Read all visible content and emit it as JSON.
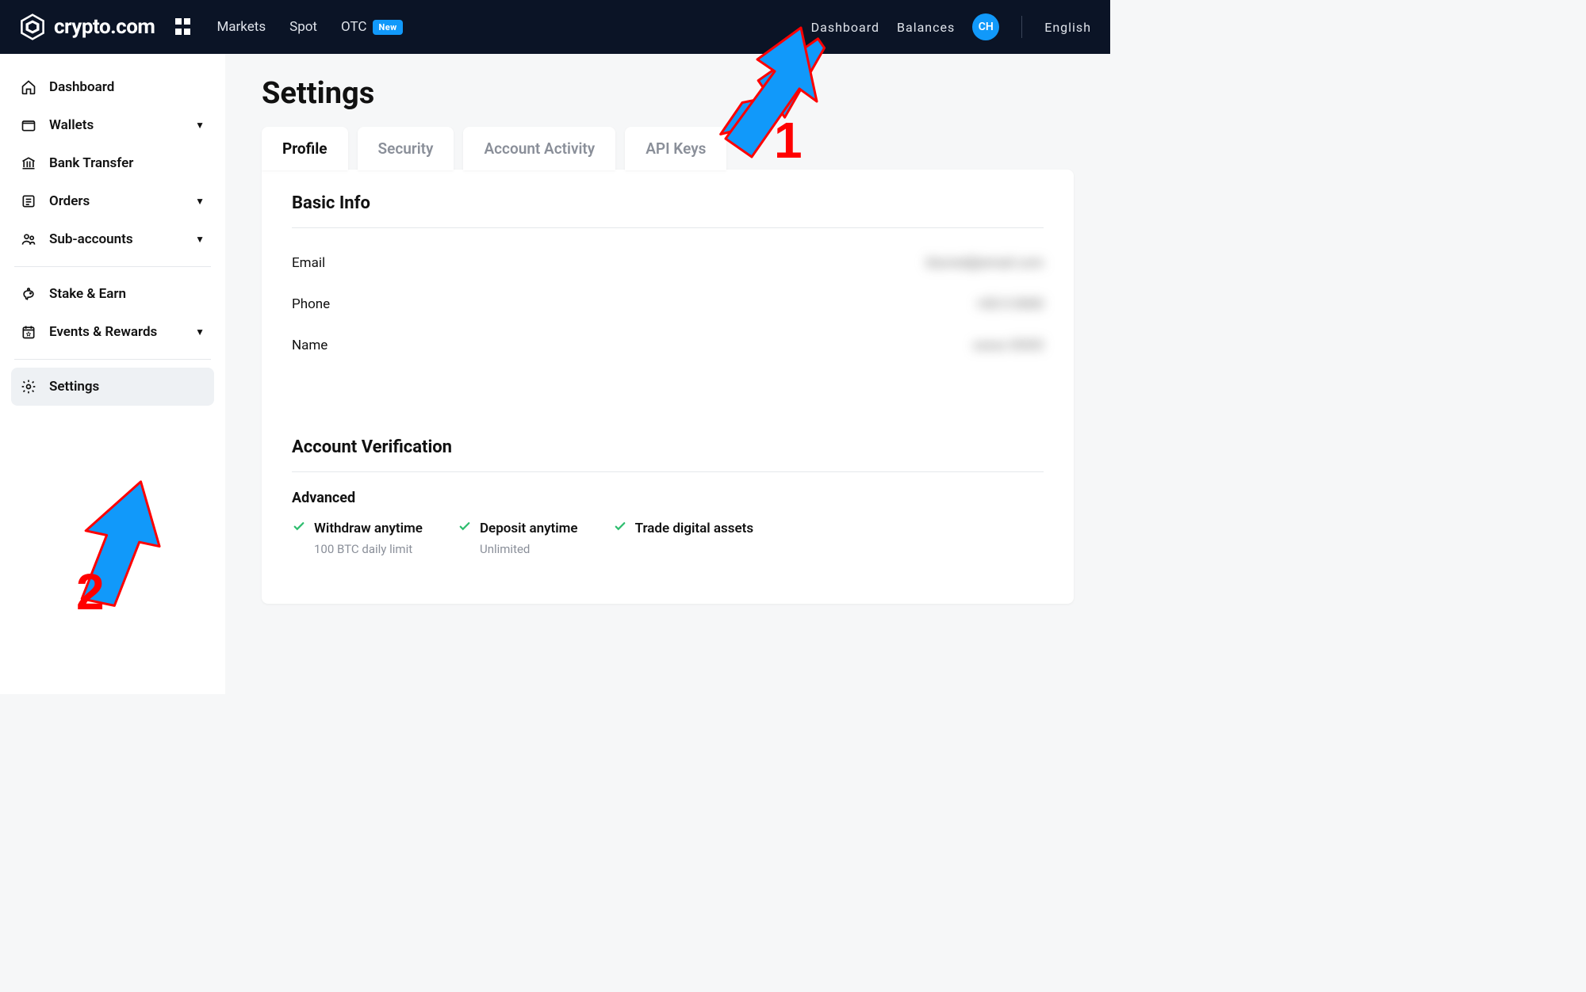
{
  "header": {
    "brand": "crypto.com",
    "nav_left": [
      "Markets",
      "Spot",
      "OTC"
    ],
    "otc_badge": "New",
    "nav_right": [
      "Dashboard",
      "Balances"
    ],
    "avatar_initials": "CH",
    "language": "English"
  },
  "sidebar": {
    "items": [
      {
        "label": "Dashboard",
        "icon": "home",
        "expandable": false
      },
      {
        "label": "Wallets",
        "icon": "wallet",
        "expandable": true
      },
      {
        "label": "Bank Transfer",
        "icon": "bank",
        "expandable": false
      },
      {
        "label": "Orders",
        "icon": "orders",
        "expandable": true
      },
      {
        "label": "Sub-accounts",
        "icon": "sub",
        "expandable": true
      },
      {
        "label": "Stake & Earn",
        "icon": "piggy",
        "expandable": false
      },
      {
        "label": "Events & Rewards",
        "icon": "calendar",
        "expandable": true
      },
      {
        "label": "Settings",
        "icon": "gear",
        "expandable": false,
        "active": true
      }
    ]
  },
  "page": {
    "title": "Settings",
    "tabs": [
      "Profile",
      "Security",
      "Account Activity",
      "API Keys"
    ],
    "active_tab": 0,
    "basic_info": {
      "heading": "Basic Info",
      "rows": [
        {
          "label": "Email",
          "value": "blurred@email.com"
        },
        {
          "label": "Phone",
          "value": "+00 0 0000"
        },
        {
          "label": "Name",
          "value": "xxxxx XXXX"
        }
      ]
    },
    "verification": {
      "heading": "Account Verification",
      "sub_heading": "Advanced",
      "features": [
        {
          "title": "Withdraw anytime",
          "subtitle": "100 BTC daily limit"
        },
        {
          "title": "Deposit anytime",
          "subtitle": "Unlimited"
        },
        {
          "title": "Trade digital assets",
          "subtitle": ""
        }
      ]
    }
  },
  "annotations": {
    "num1": "1",
    "num2": "2"
  }
}
